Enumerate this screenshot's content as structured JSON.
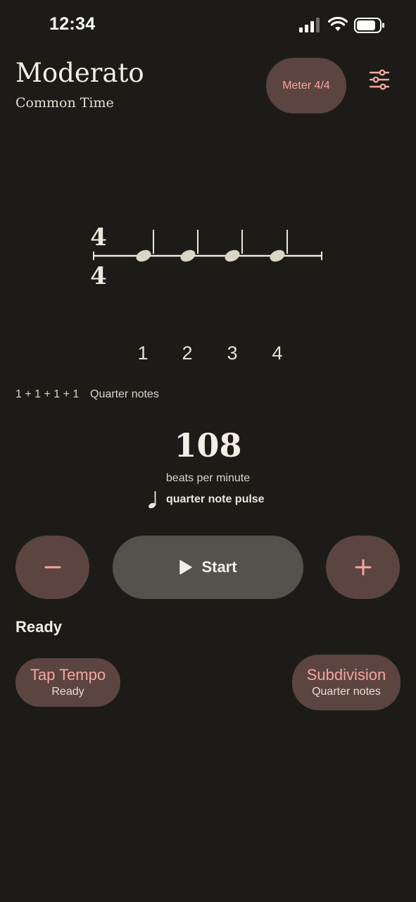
{
  "status_bar": {
    "time": "12:34"
  },
  "header": {
    "title": "Moderato",
    "subtitle": "Common Time",
    "meter_button": "Meter 4/4"
  },
  "staff": {
    "time_signature_top": "4",
    "time_signature_bottom": "4",
    "beats": [
      "1",
      "2",
      "3",
      "4"
    ]
  },
  "grouping": {
    "pattern": "1 + 1 + 1 + 1",
    "name": "Quarter notes"
  },
  "tempo": {
    "bpm": "108",
    "unit_label": "beats per minute",
    "pulse_label": "quarter note pulse"
  },
  "controls": {
    "start_label": "Start"
  },
  "status": "Ready",
  "tap_tempo": {
    "title": "Tap Tempo",
    "sub": "Ready"
  },
  "subdivision": {
    "title": "Subdivision",
    "sub": "Quarter notes"
  },
  "colors": {
    "background": "#1c1b18",
    "accent": "#f3a89f",
    "button_fill": "#5c4440",
    "start_fill": "#53524d",
    "note_fill": "#ddd5c3"
  }
}
